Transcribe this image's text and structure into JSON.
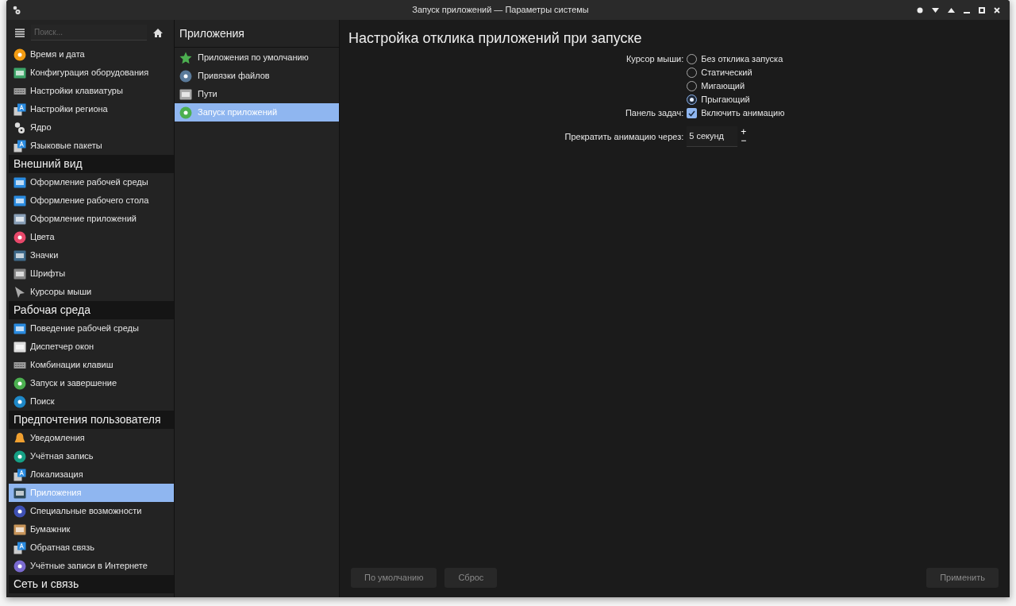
{
  "window": {
    "title": "Запуск приложений — Параметры системы"
  },
  "sidebar": {
    "search": {
      "placeholder": "Поиск..."
    },
    "groups": [
      {
        "items": [
          {
            "label": "Время и дата",
            "selected": false
          },
          {
            "label": "Конфигурация оборудования",
            "selected": false
          },
          {
            "label": "Настройки клавиатуры",
            "selected": false
          },
          {
            "label": "Настройки региона",
            "selected": false
          },
          {
            "label": "Ядро",
            "selected": false
          },
          {
            "label": "Языковые пакеты",
            "selected": false
          }
        ]
      },
      {
        "title": "Внешний вид",
        "items": [
          {
            "label": "Оформление рабочей среды",
            "selected": false
          },
          {
            "label": "Оформление рабочего стола",
            "selected": false
          },
          {
            "label": "Оформление приложений",
            "selected": false
          },
          {
            "label": "Цвета",
            "selected": false
          },
          {
            "label": "Значки",
            "selected": false
          },
          {
            "label": "Шрифты",
            "selected": false
          },
          {
            "label": "Курсоры мыши",
            "selected": false
          }
        ]
      },
      {
        "title": "Рабочая среда",
        "items": [
          {
            "label": "Поведение рабочей среды",
            "selected": false
          },
          {
            "label": "Диспетчер окон",
            "selected": false
          },
          {
            "label": "Комбинации клавиш",
            "selected": false
          },
          {
            "label": "Запуск и завершение",
            "selected": false
          },
          {
            "label": "Поиск",
            "selected": false
          }
        ]
      },
      {
        "title": "Предпочтения пользователя",
        "items": [
          {
            "label": "Уведомления",
            "selected": false
          },
          {
            "label": "Учётная запись",
            "selected": false
          },
          {
            "label": "Локализация",
            "selected": false
          },
          {
            "label": "Приложения",
            "selected": true
          },
          {
            "label": "Специальные возможности",
            "selected": false
          },
          {
            "label": "Бумажник",
            "selected": false
          },
          {
            "label": "Обратная связь",
            "selected": false
          },
          {
            "label": "Учётные записи в Интернете",
            "selected": false
          }
        ]
      },
      {
        "title": "Сеть и связь"
      }
    ]
  },
  "subpanel": {
    "title": "Приложения",
    "items": [
      {
        "label": "Приложения по умолчанию",
        "selected": false
      },
      {
        "label": "Привязки файлов",
        "selected": false
      },
      {
        "label": "Пути",
        "selected": false
      },
      {
        "label": "Запуск приложений",
        "selected": true
      }
    ]
  },
  "content": {
    "title": "Настройка отклика приложений при запуске",
    "cursor": {
      "label": "Курсор мыши:",
      "options": [
        {
          "label": "Без отклика запуска",
          "selected": false
        },
        {
          "label": "Статический",
          "selected": false
        },
        {
          "label": "Мигающий",
          "selected": false
        },
        {
          "label": "Прыгающий",
          "selected": true
        }
      ]
    },
    "taskbar": {
      "label": "Панель задач:",
      "option": "Включить анимацию",
      "checked": true
    },
    "timeout": {
      "label": "Прекратить анимацию через:",
      "value": "5 секунд",
      "increment": "+",
      "decrement": "−"
    }
  },
  "buttons": [
    {
      "label": "По умолчанию",
      "disabled": true
    },
    {
      "label": "Сброс",
      "disabled": true
    },
    {
      "label": "Применить",
      "disabled": true
    }
  ]
}
